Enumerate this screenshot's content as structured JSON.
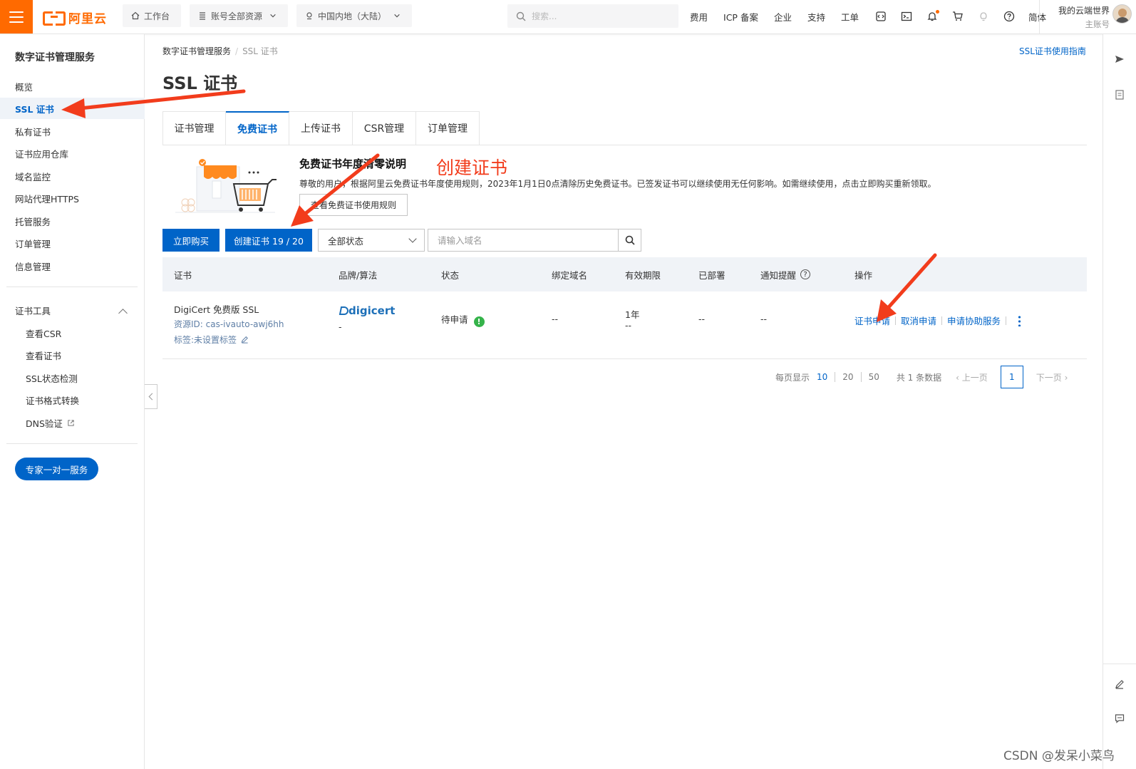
{
  "topbar": {
    "logo_text": "阿里云",
    "workbench": "工作台",
    "resources": "账号全部资源",
    "region": "中国内地（大陆）",
    "search_placeholder": "搜索...",
    "nav": [
      "费用",
      "ICP 备案",
      "企业",
      "支持",
      "工单"
    ],
    "icons": [
      "code-icon",
      "terminal-icon",
      "bell-icon",
      "cart-icon",
      "bulb-icon",
      "help-icon"
    ],
    "lang": "简体",
    "account_name": "我的云端世界",
    "account_role": "主账号"
  },
  "sidebar": {
    "title": "数字证书管理服务",
    "items": [
      "概览",
      "SSL 证书",
      "私有证书",
      "证书应用仓库",
      "域名监控",
      "网站代理HTTPS",
      "托管服务",
      "订单管理",
      "信息管理"
    ],
    "tools_title": "证书工具",
    "tools": [
      "查看CSR",
      "查看证书",
      "SSL状态检测",
      "证书格式转换",
      "DNS验证"
    ],
    "expert_button": "专家一对一服务"
  },
  "breadcrumb": {
    "root": "数字证书管理服务",
    "current": "SSL 证书"
  },
  "guide_link": "SSL证书使用指南",
  "page_title": "SSL 证书",
  "tabs": [
    "证书管理",
    "免费证书",
    "上传证书",
    "CSR管理",
    "订单管理"
  ],
  "notice": {
    "title": "免费证书年度清零说明",
    "body": "尊敬的用户，根据阿里云免费证书年度使用规则，2023年1月1日0点清除历史免费证书。已签发证书可以继续使用无任何影响。如需继续使用，点击立即购买重新领取。",
    "rule_button": "查看免费证书使用规则"
  },
  "annotation": "创建证书",
  "toolbar": {
    "buy": "立即购买",
    "create": "创建证书 19 / 20",
    "status_select": "全部状态",
    "domain_placeholder": "请输入域名"
  },
  "table": {
    "headers": [
      "证书",
      "品牌/算法",
      "状态",
      "绑定域名",
      "有效期限",
      "已部署",
      "通知提醒",
      "操作"
    ],
    "row": {
      "name": "DigiCert 免费版 SSL",
      "resource_id": "资源ID: cas-ivauto-awj6hh",
      "tags": "标签:未设置标签",
      "brand": "digicert",
      "brand_sub": "-",
      "status": "待申请",
      "domain": "--",
      "validity": "1年",
      "validity_sub": "--",
      "deployed": "--",
      "notify": "--",
      "actions": [
        "证书申请",
        "取消申请",
        "申请协助服务"
      ]
    }
  },
  "pagination": {
    "per_page_label": "每页显示",
    "sizes": [
      "10",
      "20",
      "50"
    ],
    "total": "共 1 条数据",
    "prev": "上一页",
    "page": "1",
    "next": "下一页"
  },
  "watermark": "CSDN @发呆小菜鸟",
  "colors": {
    "brand": "#ff6a00",
    "primary": "#0064c8",
    "annotation": "#f23c1c",
    "success": "#35b34a"
  }
}
